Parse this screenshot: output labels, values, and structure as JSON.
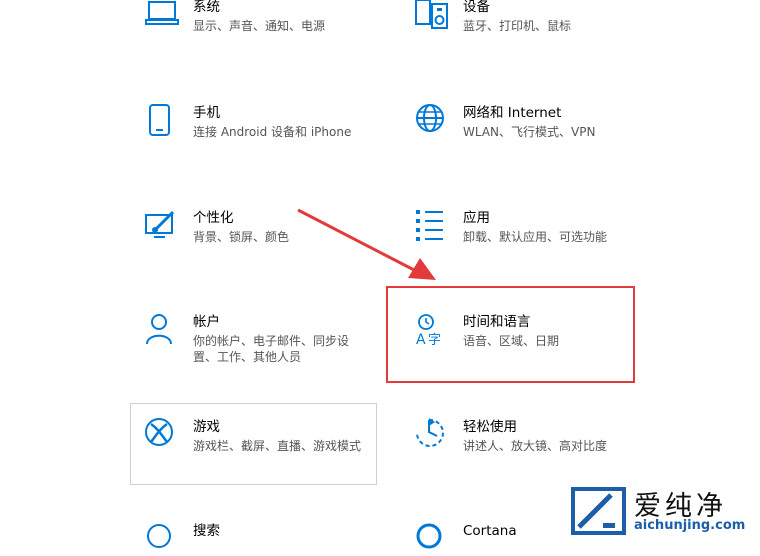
{
  "tiles": [
    {
      "title": "系统",
      "desc": "显示、声音、通知、电源",
      "icon": "laptop-icon"
    },
    {
      "title": "设备",
      "desc": "蓝牙、打印机、鼠标",
      "icon": "devices-icon"
    },
    {
      "title": "手机",
      "desc": "连接 Android 设备和 iPhone",
      "icon": "phone-icon"
    },
    {
      "title": "网络和 Internet",
      "desc": "WLAN、飞行模式、VPN",
      "icon": "globe-icon"
    },
    {
      "title": "个性化",
      "desc": "背景、锁屏、颜色",
      "icon": "personalization-icon"
    },
    {
      "title": "应用",
      "desc": "卸载、默认应用、可选功能",
      "icon": "apps-list-icon"
    },
    {
      "title": "帐户",
      "desc_line1": "你的帐户、电子邮件、同步设",
      "desc_line2": "置、工作、其他人员",
      "icon": "person-icon"
    },
    {
      "title": "时间和语言",
      "desc": "语音、区域、日期",
      "icon": "time-language-icon"
    },
    {
      "title": "游戏",
      "desc": "游戏栏、截屏、直播、游戏模式",
      "icon": "xbox-icon"
    },
    {
      "title": "轻松使用",
      "desc": "讲述人、放大镜、高对比度",
      "icon": "ease-of-access-icon"
    },
    {
      "title": "搜索",
      "icon": "search-icon"
    },
    {
      "title": "Cortana",
      "icon": "cortana-icon"
    }
  ],
  "watermark": {
    "brand": "爱纯净",
    "url": "aichunjing.com"
  },
  "colors": {
    "accent": "#0078d7",
    "highlight": "#e23b3b"
  }
}
